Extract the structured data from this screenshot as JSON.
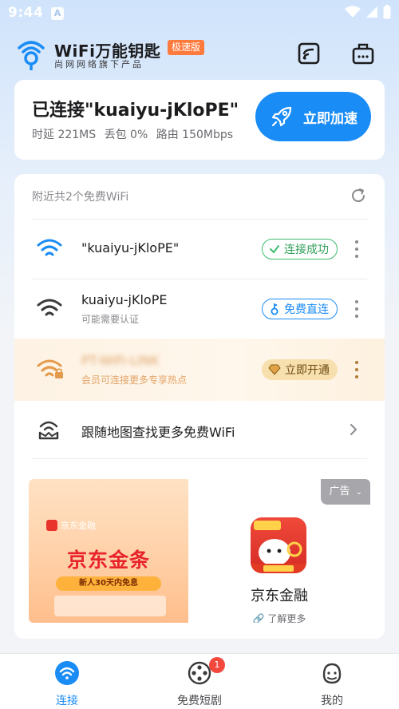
{
  "status_bar": {
    "time": "9:44",
    "notif": "A"
  },
  "header": {
    "app_name": "WiFi万能钥匙",
    "badge": "极速版",
    "subtitle": "尚网网络旗下产品"
  },
  "connected": {
    "title": "已连接\"kuaiyu-jKloPE\"",
    "latency": "时延 221MS",
    "loss": "丢包 0%",
    "route": "路由 150Mbps",
    "accelerate": "立即加速"
  },
  "nearby": {
    "heading": "附近共2个免费WiFi",
    "items": [
      {
        "name": "\"kuaiyu-jKloPE\"",
        "sub": "",
        "action": "连接成功"
      },
      {
        "name": "kuaiyu-jKloPE",
        "sub": "可能需要认证",
        "action": "免费直连"
      },
      {
        "name": "PT-WiFi-LINK",
        "sub": "会员可连接更多专享热点",
        "action": "立即开通"
      }
    ],
    "map_link": "跟随地图查找更多免费WiFi"
  },
  "ad": {
    "tag": "广告",
    "brand": "京东金融",
    "headline": "京东金条",
    "tagline": "新人30天内免息",
    "app_name": "京东金融",
    "learn_more": "了解更多"
  },
  "nav": {
    "items": [
      {
        "label": "连接"
      },
      {
        "label": "免费短剧",
        "badge": "1"
      },
      {
        "label": "我的"
      }
    ]
  },
  "colors": {
    "accent": "#1a8cf5",
    "success": "#3cbb6e",
    "vip": "#f7dfae",
    "badge": "#ff7a3d"
  }
}
